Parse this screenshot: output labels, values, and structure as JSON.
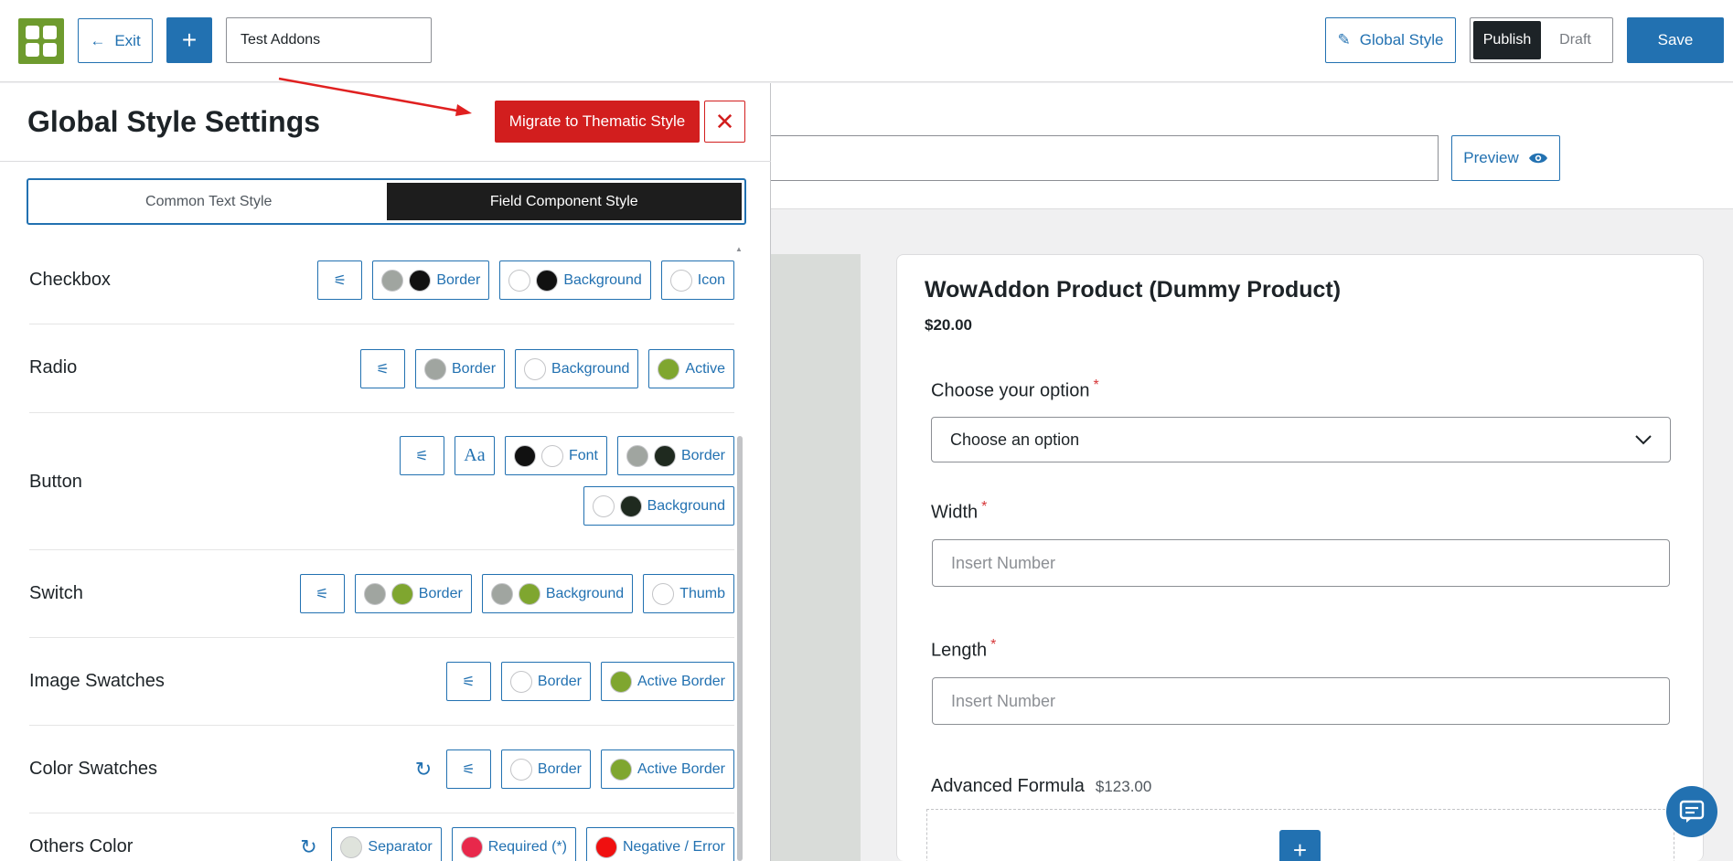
{
  "topbar": {
    "exit_label": "Exit",
    "add_label": "+",
    "title_value": "Test Addons",
    "global_style_label": "Global Style",
    "publish_label": "Publish",
    "draft_label": "Draft",
    "save_label": "Save"
  },
  "editor": {
    "preview_label": "Preview"
  },
  "product": {
    "title": "WowAddon Product (Dummy Product)",
    "price": "$20.00",
    "fields": [
      {
        "label": "Choose your option",
        "required": "*",
        "value": "Choose an option"
      },
      {
        "label": "Width",
        "required": "*",
        "placeholder": "Insert Number"
      },
      {
        "label": "Length",
        "required": "*",
        "placeholder": "Insert Number"
      },
      {
        "label": "Advanced Formula",
        "price": "$123.00"
      }
    ],
    "add_label": "+"
  },
  "panel": {
    "title": "Global Style Settings",
    "migrate_label": "Migrate to Thematic Style",
    "close_label": "✕",
    "tabs": [
      {
        "label": "Common Text Style",
        "active": false
      },
      {
        "label": "Field Component Style",
        "active": true
      }
    ],
    "rows": [
      {
        "label": "Checkbox",
        "border": "Border",
        "background": "Background",
        "icon": "Icon"
      },
      {
        "label": "Radio",
        "border": "Border",
        "background": "Background",
        "active": "Active"
      },
      {
        "label": "Button",
        "font": "Font",
        "border": "Border",
        "background": "Background",
        "aa": "Aa"
      },
      {
        "label": "Switch",
        "border": "Border",
        "background": "Background",
        "thumb": "Thumb"
      },
      {
        "label": "Image Swatches",
        "border": "Border",
        "active_border": "Active Border"
      },
      {
        "label": "Color Swatches",
        "border": "Border",
        "active_border": "Active Border"
      },
      {
        "label": "Others Color",
        "separator": "Separator",
        "required": "Required (*)",
        "negative": "Negative / Error"
      }
    ]
  },
  "colors": {
    "primary": "#2271b1",
    "migrate_red": "#d21e1e",
    "gray_dot": "#a0a5a0",
    "black_dot": "#111111",
    "green_dot": "#7fa62f",
    "dark_dot": "#1f2a1f",
    "separator_dot": "#dfe3dc",
    "required_dot": "#e8284b",
    "error_dot": "#f01010"
  }
}
